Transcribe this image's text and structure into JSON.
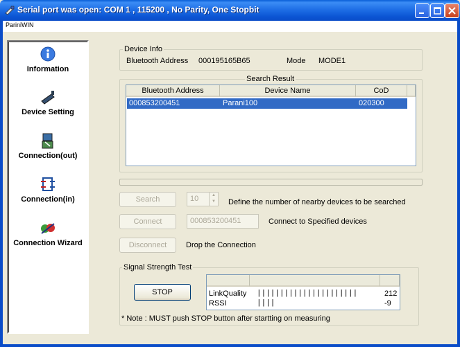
{
  "window": {
    "title": "Serial port was open: COM 1 , 115200 , No Parity, One Stopbit",
    "menu": "PariniWIN"
  },
  "sidebar": {
    "items": [
      {
        "label": "Information",
        "icon": "info-icon"
      },
      {
        "label": "Device Setting",
        "icon": "device-setting-icon"
      },
      {
        "label": "Connection(out)",
        "icon": "connection-out-icon"
      },
      {
        "label": "Connection(in)",
        "icon": "connection-in-icon"
      },
      {
        "label": "Connection Wizard",
        "icon": "connection-wizard-icon"
      }
    ]
  },
  "device_info": {
    "legend": "Device Info",
    "bt_label": "Bluetooth Address",
    "bt_value": "000195165B65",
    "mode_label": "Mode",
    "mode_value": "MODE1"
  },
  "search_result": {
    "legend": "Search Result",
    "columns": [
      "Bluetooth Address",
      "Device Name",
      "CoD"
    ],
    "rows": [
      {
        "address": "000853200451",
        "name": "Parani100",
        "cod": "020300",
        "selected": true
      }
    ]
  },
  "controls": {
    "search_button": "Search",
    "search_count": "10",
    "search_desc": "Define the number of nearby devices to be searched",
    "connect_button": "Connect",
    "connect_address": "000853200451",
    "connect_desc": "Connect to Specified devices",
    "disconnect_button": "Disconnect",
    "disconnect_desc": "Drop the Connection"
  },
  "signal": {
    "legend": "Signal Strength Test",
    "stop_button": "STOP",
    "link_quality_label": "LinkQuality",
    "link_quality_bars": "||||||||||||||||||||||",
    "link_quality_value": "212",
    "rssi_label": "RSSI",
    "rssi_bars": "||||",
    "rssi_value": "-9",
    "note": "* Note : MUST push STOP button after startting on measuring"
  },
  "colors": {
    "titlebar": "#0a55d4",
    "selection": "#316ac5",
    "window_bg": "#ece9d8"
  }
}
